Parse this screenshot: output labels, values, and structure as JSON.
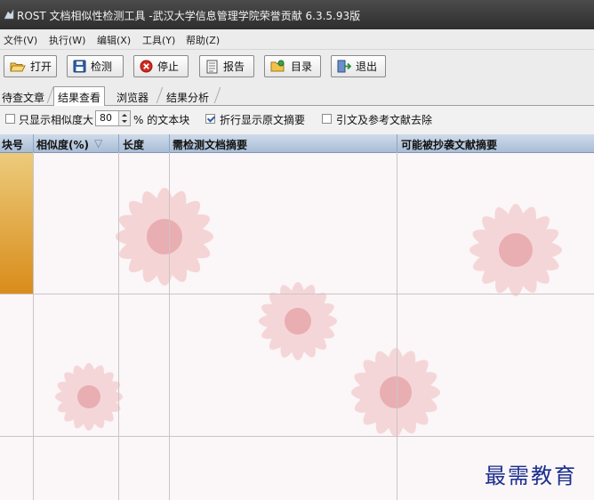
{
  "window": {
    "title": "ROST 文档相似性检测工具 -武汉大学信息管理学院荣誉贡献 6.3.5.93版"
  },
  "menu": [
    "文件(V)",
    "执行(W)",
    "编辑(X)",
    "工具(Y)",
    "帮助(Z)"
  ],
  "toolbar": {
    "open": "打开",
    "detect": "检测",
    "stop": "停止",
    "report": "报告",
    "catalog": "目录",
    "exit": "退出"
  },
  "tabs": [
    "待查文章",
    "结果查看",
    "浏览器",
    "结果分析"
  ],
  "active_tab": "结果查看",
  "filter": {
    "only_show_label": "只显示相似度大",
    "similarity_value": "80",
    "text_block_suffix": "% 的文本块",
    "wrap_label": "折行显示原文摘要",
    "wrap_checked": true,
    "citation_label": "引文及参考文献去除",
    "citation_checked": false,
    "only_show_checked": false
  },
  "table": {
    "columns": [
      "块号",
      "相似度(%)",
      "长度",
      "需检测文档摘要",
      "可能被抄袭文献摘要"
    ],
    "sort_indicator": "▽"
  },
  "watermark": "最需教育",
  "colors": {
    "title_bar": "#3a3a3a",
    "header": "#b9cbe0",
    "highlight": "#e3a53a",
    "watermark": "#1b2f8f"
  }
}
